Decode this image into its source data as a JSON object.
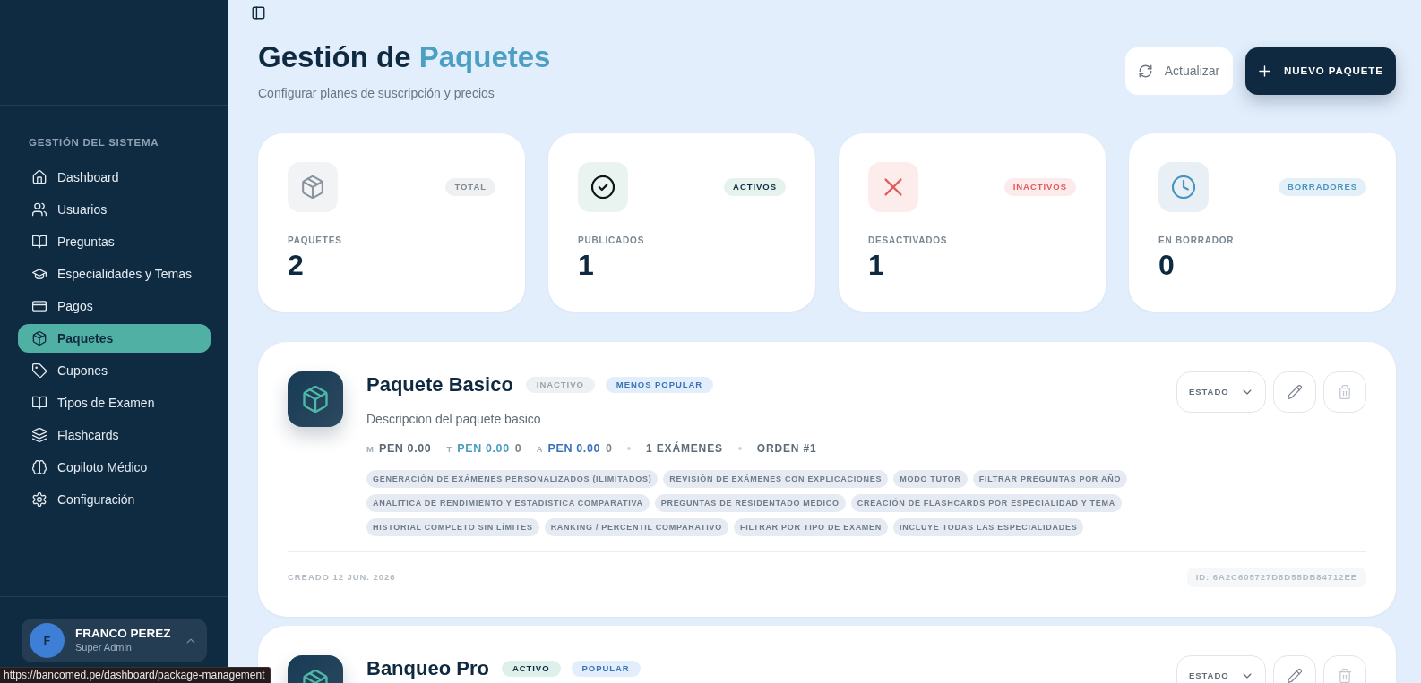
{
  "sidebar": {
    "section_title": "GESTIÓN DEL SISTEMA",
    "items": [
      {
        "label": "Dashboard",
        "selected": false
      },
      {
        "label": "Usuarios",
        "selected": false
      },
      {
        "label": "Preguntas",
        "selected": false
      },
      {
        "label": "Especialidades y Temas",
        "selected": false
      },
      {
        "label": "Pagos",
        "selected": false
      },
      {
        "label": "Paquetes",
        "selected": true
      },
      {
        "label": "Cupones",
        "selected": false
      },
      {
        "label": "Tipos de Examen",
        "selected": false
      },
      {
        "label": "Flashcards",
        "selected": false
      },
      {
        "label": "Copiloto Médico",
        "selected": false
      },
      {
        "label": "Configuración",
        "selected": false
      }
    ],
    "user": {
      "initial": "F",
      "name": "FRANCO PEREZ",
      "role": "Super Admin"
    }
  },
  "header": {
    "title": "Gestión de",
    "title_accent": "Paquetes",
    "subtitle": "Configurar planes de suscripción y precios",
    "buttons": [
      {
        "label": "Actualizar",
        "kind": "refresh"
      },
      {
        "label": "NUEVO PAQUETE",
        "kind": "create"
      }
    ]
  },
  "stats": [
    {
      "kind": "total",
      "badge": "TOTAL",
      "label": "PAQUETES",
      "value": "2"
    },
    {
      "kind": "active",
      "badge": "ACTIVOS",
      "label": "PUBLICADOS",
      "value": "1"
    },
    {
      "kind": "inactive",
      "badge": "INACTIVOS",
      "label": "DESACTIVADOS",
      "value": "1"
    },
    {
      "kind": "draft",
      "badge": "BORRADORES",
      "label": "EN BORRADOR",
      "value": "0"
    }
  ],
  "packages": [
    {
      "name": "Paquete Basico",
      "status": {
        "label": "INACTIVO",
        "active": false
      },
      "popularity": "MENOS POPULAR",
      "description": "Descripcion del paquete basico",
      "prices": [
        {
          "period": "M",
          "amount": "PEN 0.00",
          "color": "#5b6672"
        },
        {
          "period": "T",
          "amount": "PEN 0.00",
          "note": "0",
          "color": "#4a9dc0"
        },
        {
          "period": "A",
          "amount": "PEN 0.00",
          "note": "0",
          "color": "#3a72b8"
        }
      ],
      "exams": "1 EXÁMENES",
      "order": "ORDEN #1",
      "features": [
        "GENERACIÓN DE EXÁMENES PERSONALIZADOS (ILIMITADOS)",
        "REVISIÓN DE EXÁMENES CON EXPLICACIONES",
        "MODO TUTOR",
        "FILTRAR PREGUNTAS POR AÑO",
        "ANALÍTICA DE RENDIMIENTO Y ESTADÍSTICA COMPARATIVA",
        "PREGUNTAS DE RESIDENTADO MÉDICO",
        "CREACIÓN DE FLASHCARDS POR ESPECIALIDAD Y TEMA",
        "HISTORIAL COMPLETO SIN LÍMITES",
        "RANKING / PERCENTIL COMPARATIVO",
        "FILTRAR POR TIPO DE EXAMEN",
        "INCLUYE TODAS LAS ESPECIALIDADES"
      ],
      "created": "CREADO 12 JUN. 2026",
      "id": "ID: 6A2C605727D8D55DB84712EE",
      "status_menu": "ESTADO"
    },
    {
      "name": "Banqueo Pro",
      "status": {
        "label": "ACTIVO",
        "active": true
      },
      "popularity": "POPULAR",
      "status_menu": "ESTADO"
    }
  ],
  "status_bar": {
    "url": "https://bancomed.pe/dashboard/package-management"
  }
}
